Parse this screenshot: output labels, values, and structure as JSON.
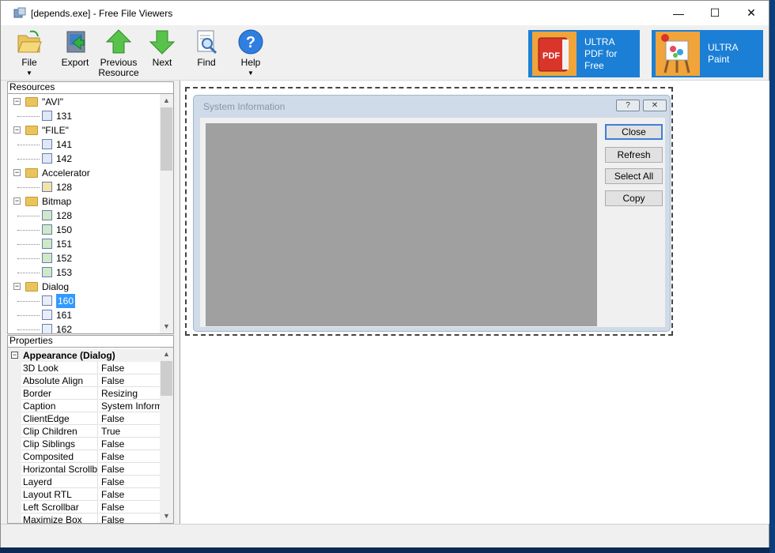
{
  "window": {
    "title": "[depends.exe] - Free File Viewers",
    "controls": {
      "minimize": "—",
      "maximize": "☐",
      "close": "✕"
    }
  },
  "toolbar": {
    "file": "File",
    "export": "Export",
    "previous": "Previous Resource",
    "next": "Next",
    "find": "Find",
    "help": "Help"
  },
  "ads": [
    {
      "line1": "ULTRA",
      "line2": "PDF for",
      "line3": "Free",
      "badge": "PDF"
    },
    {
      "line1": "ULTRA",
      "line2": "Paint"
    }
  ],
  "resources": {
    "title": "Resources",
    "items": [
      {
        "label": "\"AVI\"",
        "level": 0,
        "type": "folder"
      },
      {
        "label": "131",
        "level": 1,
        "type": "res"
      },
      {
        "label": "\"FILE\"",
        "level": 0,
        "type": "folder"
      },
      {
        "label": "141",
        "level": 1,
        "type": "res"
      },
      {
        "label": "142",
        "level": 1,
        "type": "res"
      },
      {
        "label": "Accelerator",
        "level": 0,
        "type": "folder"
      },
      {
        "label": "128",
        "level": 1,
        "type": "accel"
      },
      {
        "label": "Bitmap",
        "level": 0,
        "type": "folder"
      },
      {
        "label": "128",
        "level": 1,
        "type": "bmp"
      },
      {
        "label": "150",
        "level": 1,
        "type": "bmp"
      },
      {
        "label": "151",
        "level": 1,
        "type": "bmp"
      },
      {
        "label": "152",
        "level": 1,
        "type": "bmp"
      },
      {
        "label": "153",
        "level": 1,
        "type": "bmp"
      },
      {
        "label": "Dialog",
        "level": 0,
        "type": "folder"
      },
      {
        "label": "160",
        "level": 1,
        "type": "dlg",
        "selected": true
      },
      {
        "label": "161",
        "level": 1,
        "type": "dlg"
      },
      {
        "label": "162",
        "level": 1,
        "type": "dlg"
      }
    ]
  },
  "properties": {
    "title": "Properties",
    "category": "Appearance (Dialog)",
    "rows": [
      {
        "k": "3D Look",
        "v": "False"
      },
      {
        "k": "Absolute Align",
        "v": "False"
      },
      {
        "k": "Border",
        "v": "Resizing"
      },
      {
        "k": "Caption",
        "v": "System Inform..."
      },
      {
        "k": "ClientEdge",
        "v": "False"
      },
      {
        "k": "Clip Children",
        "v": "True"
      },
      {
        "k": "Clip Siblings",
        "v": "False"
      },
      {
        "k": "Composited",
        "v": "False"
      },
      {
        "k": "Horizontal Scrollbar",
        "v": "False"
      },
      {
        "k": "Layerd",
        "v": "False"
      },
      {
        "k": "Layout RTL",
        "v": "False"
      },
      {
        "k": "Left Scrollbar",
        "v": "False"
      },
      {
        "k": "Maximize Box",
        "v": "False"
      }
    ]
  },
  "preview": {
    "title": "System Information",
    "help_btn": "?",
    "close_btn": "✕",
    "buttons": [
      "Close",
      "Refresh",
      "Select All",
      "Copy"
    ]
  }
}
